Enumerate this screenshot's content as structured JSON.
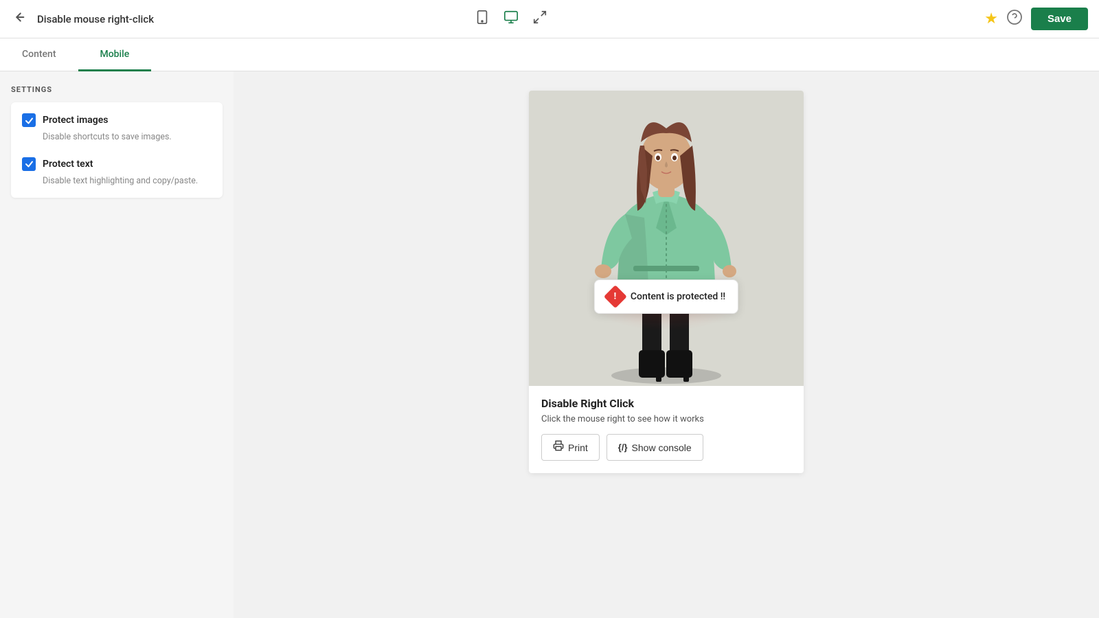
{
  "header": {
    "back_icon": "←",
    "title": "Disable mouse right-click",
    "device_icons": [
      "tablet",
      "desktop",
      "fullscreen"
    ],
    "star_icon": "★",
    "help_icon": "?",
    "save_label": "Save"
  },
  "tabs": [
    {
      "id": "content",
      "label": "Content",
      "active": false
    },
    {
      "id": "mobile",
      "label": "Mobile",
      "active": true
    }
  ],
  "sidebar": {
    "settings_label": "SETTINGS",
    "card": {
      "items": [
        {
          "id": "protect-images",
          "title": "Protect images",
          "desc": "Disable shortcuts to save images.",
          "checked": true
        },
        {
          "id": "protect-text",
          "title": "Protect text",
          "desc": "Disable text highlighting and copy/paste.",
          "checked": true
        }
      ]
    }
  },
  "preview": {
    "tooltip": {
      "text": "Content is protected !!"
    },
    "card": {
      "title": "Disable Right Click",
      "desc": "Click the mouse right to see how it works",
      "actions": [
        {
          "id": "print",
          "icon": "🖨",
          "label": "Print"
        },
        {
          "id": "console",
          "icon": "{/}",
          "label": "Show console"
        }
      ]
    }
  }
}
